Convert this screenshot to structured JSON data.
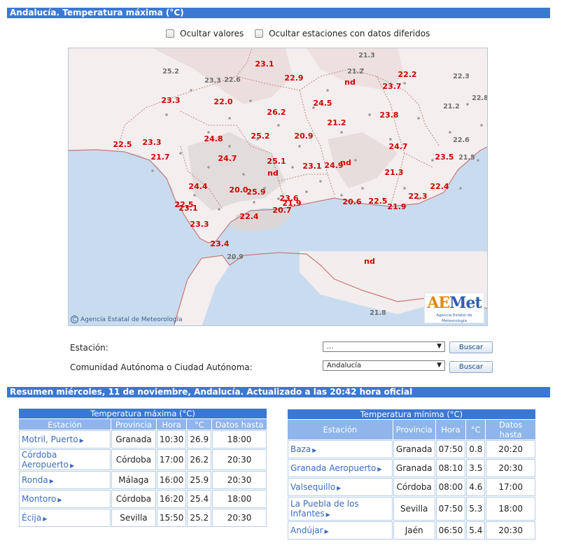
{
  "title_bar": "Andalucía. Temperatura máxima (°C)",
  "options": {
    "hide_values": "Ocultar valores",
    "hide_deferred": "Ocultar estaciones con datos diferidos"
  },
  "map": {
    "credit": "Agencia Estatal de Meteorología",
    "credit_icon": "copyright-icon",
    "logo_text_a": "AE",
    "logo_text_b": "Met",
    "logo_sub": "Agencia Estatal de Meteorología",
    "values": [
      {
        "text": "25.2",
        "kind": "grey"
      },
      {
        "text": "23.3",
        "kind": "grey"
      },
      {
        "text": "22.6",
        "kind": "grey"
      },
      {
        "text": "23.1",
        "kind": "red"
      },
      {
        "text": "21.3",
        "kind": "grey"
      },
      {
        "text": "22.9",
        "kind": "red"
      },
      {
        "text": "21.2",
        "kind": "grey"
      },
      {
        "text": "nd",
        "kind": "red"
      },
      {
        "text": "22.2",
        "kind": "red"
      },
      {
        "text": "22.3",
        "kind": "grey"
      },
      {
        "text": "23.7",
        "kind": "red"
      },
      {
        "text": "22.8",
        "kind": "grey"
      },
      {
        "text": "23.3",
        "kind": "red"
      },
      {
        "text": "22.0",
        "kind": "red"
      },
      {
        "text": "24.5",
        "kind": "red"
      },
      {
        "text": "21.2",
        "kind": "grey"
      },
      {
        "text": "26.2",
        "kind": "red"
      },
      {
        "text": "23.8",
        "kind": "red"
      },
      {
        "text": "21.2",
        "kind": "red"
      },
      {
        "text": "24.8",
        "kind": "red"
      },
      {
        "text": "25.2",
        "kind": "red"
      },
      {
        "text": "20.9",
        "kind": "red"
      },
      {
        "text": "22.6",
        "kind": "grey"
      },
      {
        "text": "22.5",
        "kind": "red"
      },
      {
        "text": "23.3",
        "kind": "red"
      },
      {
        "text": "24.7",
        "kind": "red"
      },
      {
        "text": "21.7",
        "kind": "red"
      },
      {
        "text": "23.5",
        "kind": "red"
      },
      {
        "text": "21.5",
        "kind": "grey"
      },
      {
        "text": "24.7",
        "kind": "red"
      },
      {
        "text": "25.1",
        "kind": "red"
      },
      {
        "text": "23.1",
        "kind": "red"
      },
      {
        "text": "24.9",
        "kind": "red"
      },
      {
        "text": "nd",
        "kind": "red"
      },
      {
        "text": "nd",
        "kind": "red"
      },
      {
        "text": "21.3",
        "kind": "red"
      },
      {
        "text": "24.4",
        "kind": "red"
      },
      {
        "text": "20.0",
        "kind": "red"
      },
      {
        "text": "25.9",
        "kind": "red"
      },
      {
        "text": "22.4",
        "kind": "red"
      },
      {
        "text": "23.6",
        "kind": "red"
      },
      {
        "text": "22.3",
        "kind": "red"
      },
      {
        "text": "22.5",
        "kind": "red"
      },
      {
        "text": "21.9",
        "kind": "red"
      },
      {
        "text": "20.6",
        "kind": "red"
      },
      {
        "text": "22.5",
        "kind": "red"
      },
      {
        "text": "23.1",
        "kind": "red"
      },
      {
        "text": "20.7",
        "kind": "red"
      },
      {
        "text": "21.9",
        "kind": "red"
      },
      {
        "text": "22.4",
        "kind": "red"
      },
      {
        "text": "23.3",
        "kind": "red"
      },
      {
        "text": "23.4",
        "kind": "red"
      },
      {
        "text": "20.9",
        "kind": "grey"
      },
      {
        "text": "nd",
        "kind": "red"
      },
      {
        "text": "21.8",
        "kind": "grey"
      }
    ]
  },
  "form": {
    "station_label": "Estación:",
    "station_value": "...",
    "region_label": "Comunidad Autónoma o Ciudad Autónoma:",
    "region_value": "Andalucía",
    "search_label": "Buscar"
  },
  "summary_bar": "Resumen miércoles, 11 de noviembre, Andalucía. Actualizado a las 20:42 hora oficial",
  "max_table": {
    "caption": "Temperatura máxima (°C)",
    "headers": [
      "Estación",
      "Provincia",
      "Hora",
      "°C",
      "Datos hasta"
    ],
    "rows": [
      {
        "station": "Motril, Puerto",
        "province": "Granada",
        "time": "10:30",
        "temp": "26.9",
        "until": "18:00"
      },
      {
        "station": "Córdoba Aeropuerto",
        "province": "Córdoba",
        "time": "17:00",
        "temp": "26.2",
        "until": "20:30"
      },
      {
        "station": "Ronda",
        "province": "Málaga",
        "time": "16:00",
        "temp": "25.9",
        "until": "20:30"
      },
      {
        "station": "Montoro",
        "province": "Córdoba",
        "time": "16:20",
        "temp": "25.4",
        "until": "18:00"
      },
      {
        "station": "Écija",
        "province": "Sevilla",
        "time": "15:50",
        "temp": "25.2",
        "until": "20:30"
      }
    ]
  },
  "min_table": {
    "caption": "Temperatura mínima (°C)",
    "headers": [
      "Estación",
      "Provincia",
      "Hora",
      "°C",
      "Datos hasta"
    ],
    "rows": [
      {
        "station": "Baza",
        "province": "Granada",
        "time": "07:50",
        "temp": "0.8",
        "until": "20:20"
      },
      {
        "station": "Granada Aeropuerto",
        "province": "Granada",
        "time": "08:10",
        "temp": "3.5",
        "until": "20:30"
      },
      {
        "station": "Valsequillo",
        "province": "Córdoba",
        "time": "08:00",
        "temp": "4.6",
        "until": "17:00"
      },
      {
        "station": "La Puebla de los Infantes",
        "province": "Sevilla",
        "time": "07:50",
        "temp": "5.3",
        "until": "18:00"
      },
      {
        "station": "Andújar",
        "province": "Jaén",
        "time": "06:50",
        "temp": "5.4",
        "until": "20:30"
      }
    ]
  }
}
